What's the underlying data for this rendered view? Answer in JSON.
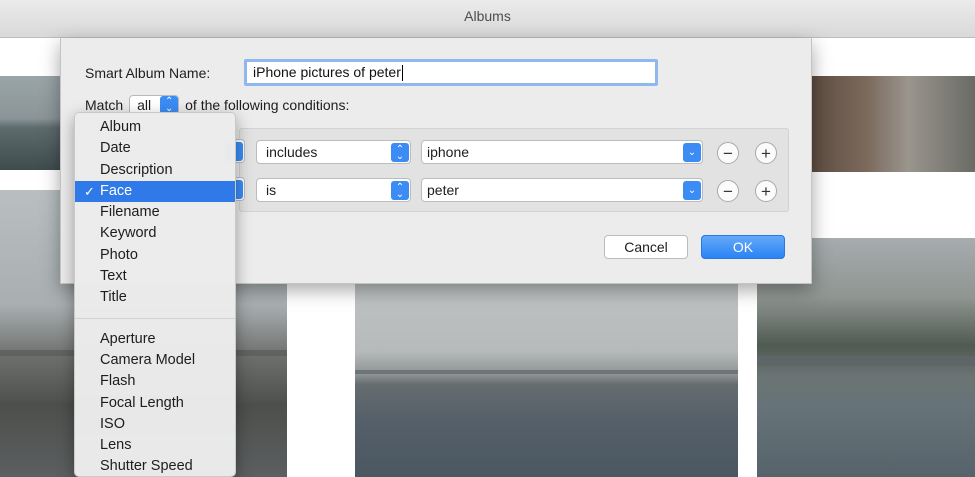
{
  "window": {
    "title": "Albums"
  },
  "dialog": {
    "name_label": "Smart Album Name:",
    "name_value": "iPhone pictures of peter",
    "match_prefix": "Match",
    "match_value": "all",
    "match_suffix": "of the following conditions:",
    "conditions": [
      {
        "field": "Face",
        "operator": "includes",
        "value": "iphone"
      },
      {
        "field": "Face",
        "operator": "is",
        "value": "peter"
      }
    ],
    "remove_symbol": "−",
    "add_symbol": "+",
    "cancel_label": "Cancel",
    "ok_label": "OK"
  },
  "menu": {
    "checkmark": "✓",
    "group1": [
      "Album",
      "Date",
      "Description",
      "Face",
      "Filename",
      "Keyword",
      "Photo",
      "Text",
      "Title"
    ],
    "group2": [
      "Aperture",
      "Camera Model",
      "Flash",
      "Focal Length",
      "ISO",
      "Lens",
      "Shutter Speed"
    ],
    "selected": "Face"
  },
  "colors": {
    "accent": "#2f79e8",
    "ok_button": "#3b8cf5",
    "focus_ring": "#8fb9ee"
  },
  "icons": [
    "popup-stepper-icon",
    "combo-chevron-icon",
    "minus-icon",
    "plus-icon",
    "checkmark-icon"
  ]
}
